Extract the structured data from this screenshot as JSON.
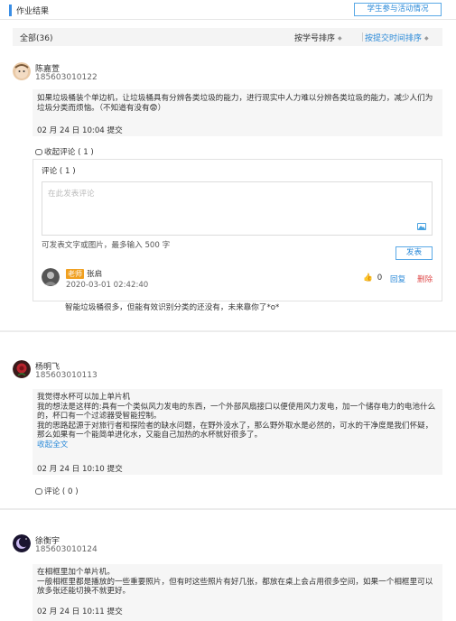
{
  "header": {
    "title": "作业结果",
    "right_button": "学生参与活动情况"
  },
  "sortbar": {
    "all_label": "全部(36)",
    "sort_by_number": "按学号排序",
    "sort_by_time": "按提交时间排序",
    "caret": "◆"
  },
  "posts": [
    {
      "name": "陈嘉萱",
      "id": "185603010122",
      "content": "如果垃圾桶装个单边机，让垃圾桶具有分辨各类垃圾的能力，进行现实中人力难以分辨各类垃圾的能力，减少人们为垃圾分类而烦恼。（不知道有没有😨）",
      "time": "02 月 24 日 10:04 提交",
      "fold_label": "收起评论 ( 1 )",
      "comment_panel": {
        "title": "评论 ( 1 )",
        "placeholder": "在此发表评论",
        "hint": "可发表文字或图片，最多输入 500 字",
        "submit": "发表",
        "replies": [
          {
            "tag": "老师",
            "name": "张启",
            "time": "2020-03-01 02:42:40",
            "likes": "0",
            "reply": "回复",
            "delete": "删除",
            "text": "智能垃圾桶很多，但能有效识别分类的还没有，未来靠你了*o*"
          }
        ]
      }
    },
    {
      "name": "杨明飞",
      "id": "185603010113",
      "content_lines": [
        "我觉得水杯可以加上单片机",
        "我的想法是这样的:具有一个类似风力发电的东西，一个外部风扇接口以便使用风力发电，加一个储存电力的电池什么的，杯口有一个过滤器受智能控制。",
        "我的思路起源于对旅行者和探险者的缺水问题，在野外没水了，那么野外取水是必然的，可水的干净度是我们怀疑，那么如果有一个能简单进化水，又能自己加热的水杯就好很多了。"
      ],
      "fold_text": "收起全文",
      "time": "02 月 24 日 10:10 提交",
      "comment_label": "评论 ( 0 )"
    },
    {
      "name": "徐衡宇",
      "id": "185603010124",
      "content_lines": [
        "在相框里加个单片机。",
        "一般相框里都是播放的一些重要照片，但有时这些照片有好几张，都放在桌上会占用很多空间，如果一个相框里可以放多张还能切换不就更好。"
      ],
      "time": "02 月 24 日 10:11 提交"
    }
  ]
}
